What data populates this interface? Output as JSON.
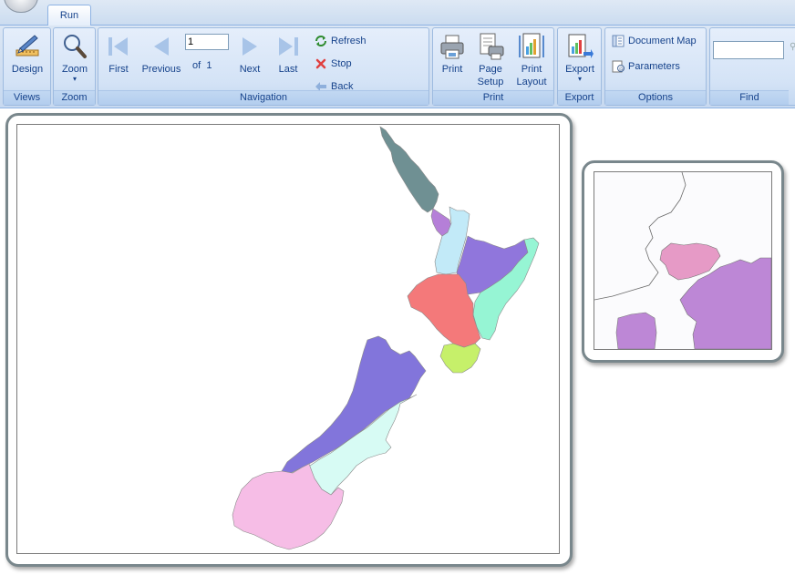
{
  "tabs": [
    {
      "label": "Run"
    }
  ],
  "ribbon": {
    "views": {
      "design_label": "Design",
      "group_label": "Views"
    },
    "zoom": {
      "zoom_label": "Zoom",
      "group_label": "Zoom"
    },
    "navigation": {
      "first_label": "First",
      "previous_label": "Previous",
      "page_value": "1",
      "of_label": "of",
      "total_pages": "1",
      "next_label": "Next",
      "last_label": "Last",
      "refresh_label": "Refresh",
      "stop_label": "Stop",
      "back_label": "Back",
      "group_label": "Navigation"
    },
    "print": {
      "print_label": "Print",
      "page_setup_label_1": "Page",
      "page_setup_label_2": "Setup",
      "print_layout_label_1": "Print",
      "print_layout_label_2": "Layout",
      "group_label": "Print"
    },
    "export": {
      "export_label": "Export",
      "group_label": "Export"
    },
    "options": {
      "document_map_label": "Document Map",
      "parameters_label": "Parameters",
      "group_label": "Options"
    },
    "find": {
      "search_value": "",
      "group_label": "Find"
    }
  },
  "map_colors": {
    "northland": "#6f9093",
    "auckland": "#b57fd8",
    "waikato": "#c2eaf8",
    "bay_of_plenty": "#9076dc",
    "hawkes_bay": "#96f5d4",
    "taranaki_manawatu": "#f4797a",
    "wellington": "#c6f06a",
    "west_coast": "#8275db",
    "canterbury": "#d7fbf4",
    "otago_southland": "#f6bde6",
    "inset_pink": "#e69ac6",
    "inset_purple": "#bd87d6"
  }
}
